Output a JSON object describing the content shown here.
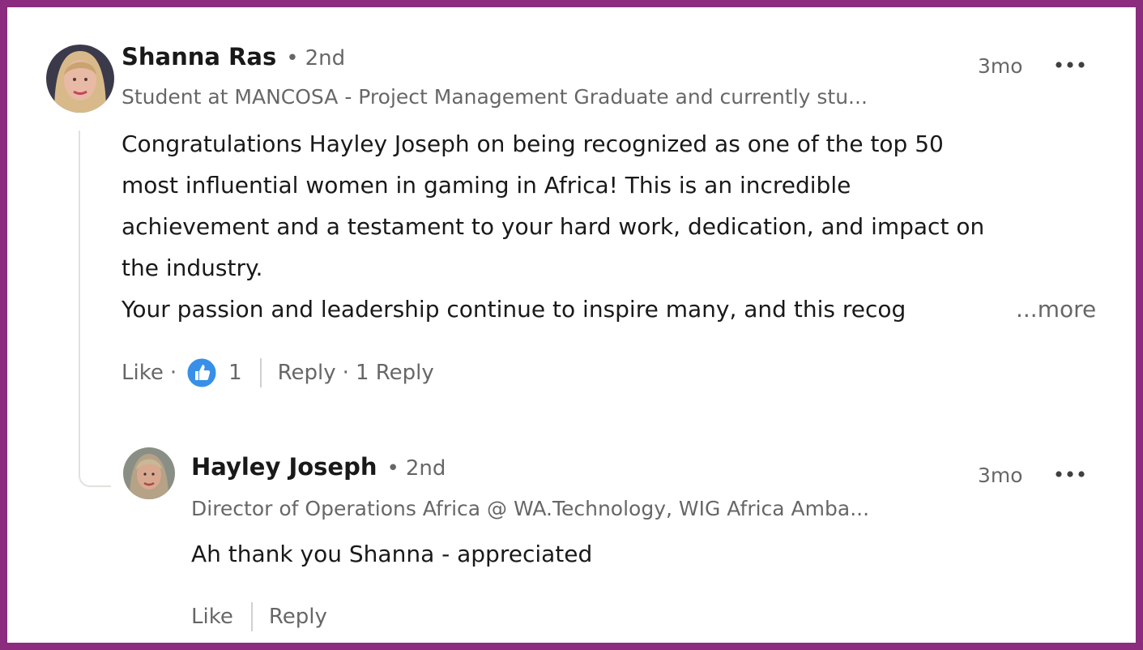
{
  "comment": {
    "author": "Shanna Ras",
    "degree": "2nd",
    "degree_dot": "•",
    "headline": "Student at MANCOSA - Project Management Graduate and currently stu...",
    "time": "3mo",
    "body_lines": [
      "Congratulations Hayley Joseph on being recognized as one of the top 50",
      "most influential women in gaming in Africa! This is an incredible",
      "achievement and a testament to your hard work, dedication, and impact on",
      "the industry.",
      "Your passion and leadership continue to inspire many, and this recog"
    ],
    "see_more": "...more",
    "actions": {
      "like_label": "Like",
      "dot": "·",
      "reaction_count": "1",
      "reply_label": "Reply",
      "replies_count": "1 Reply"
    }
  },
  "reply": {
    "author": "Hayley Joseph",
    "degree": "2nd",
    "degree_dot": "•",
    "headline": "Director of Operations Africa @ WA.Technology, WIG Africa Amba...",
    "time": "3mo",
    "body": "Ah thank you Shanna - appreciated",
    "actions": {
      "like_label": "Like",
      "reply_label": "Reply"
    }
  },
  "icons": {
    "more": "more-options-icon",
    "reaction": "thumbs-up-reaction-icon"
  },
  "colors": {
    "frame_border": "#8b2c7f",
    "reaction_blue": "#378fe9",
    "thread_line": "#e3e1dc"
  }
}
